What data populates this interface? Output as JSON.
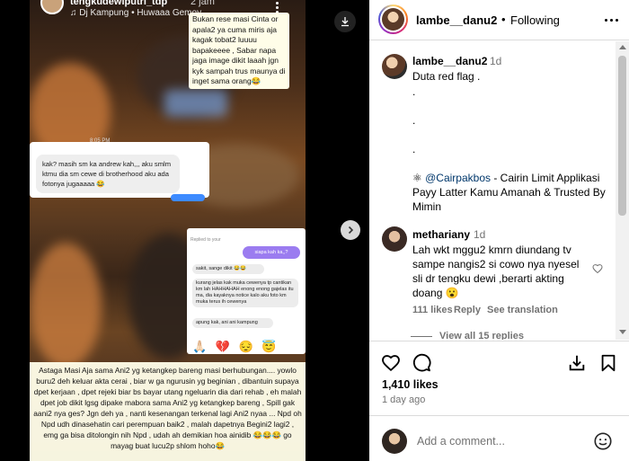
{
  "story": {
    "username": "tengkudewiputri_tdp",
    "time": "2 jam",
    "music": "♫ Dj Kampung • Huwaaa Gemoy"
  },
  "overlay": {
    "top_right_text": "Bukan rese masi Cinta or apala2 ya cuma miris aja kagak tobat2 luuuu bapakeeee , Sabar napa jaga image dikit laaah jgn kyk sampah trus maunya di inget sama orang😂",
    "chat_time": "8:05 PM",
    "chat_text": "kak? masih sm ka andrew kah,,, aku smlm ktmu dia sm cewe di brotherhood aku ada fotonya jugaaaaa 😂",
    "dm": {
      "replied": "Replied to your",
      "bubble_purple": "siapa kah ka,,?",
      "line1": "sakit, sange dikit 😂😂",
      "line2": "kurang jelas kak muka cewenya tp cantikan km lah HAHHAHAH enong enong gajelas itu ma, dia kayaknya notice kalo aku foto km muka terus ih cewenya",
      "line3": "apung kak, ani ani kampung",
      "emojis": "🙏🏻 💔 😔 😇"
    },
    "bottom_caption": "Astaga Masi Aja sama Ani2 yg ketangkep bareng masi berhubungan.... yowlo buru2 deh keluar akta cerai , biar w ga ngurusin yg beginian , dibantuin supaya dpet kerjaan , dpet rejeki biar bs bayar utang ngeluarin dia dari rehab , eh malah dpet job dikit lgsg dipake mabora sama Ani2 yg ketangkep bareng , Spill gak aani2 nya ges? Jgn deh ya , nanti kesenangan terkenal lagi Ani2 nyaa ... Npd oh Npd udh dinasehatin cari perempuan baik2 , malah dapetnya Begini2 lagi2 , emg ga bisa ditolongin nih Npd , udah ah demikian hoa ainidib 😂😂😂 go mayag buat lucu2p shlom hoho😂"
  },
  "post": {
    "author": "lambe__danu2",
    "follow_label": "Following",
    "dot": "•",
    "caption_user": "lambe__danu2",
    "caption_time": "1d",
    "caption_lines": [
      "Duta red flag .",
      ".",
      ".",
      "."
    ],
    "caption_promo_mention": "@Cairpakbos",
    "caption_promo_emoji": "⚛",
    "caption_promo_rest": " - Cairin Limit Applikasi Payy Latter Kamu Amanah & Trusted By Mimin",
    "comment": {
      "user": "metharianу",
      "time": "1d",
      "text": "Lah wkt mggu2 kmrn diundang tv sampe nangis2 si cowo nya nyesel sli dr tengku dewi ,berarti akting doang 😮",
      "likes": "111 likes",
      "reply": "Reply",
      "translate": "See translation"
    },
    "view_all": "View all 15 replies",
    "likes_count": "1,410 likes",
    "ago": "1 day ago",
    "add_comment_placeholder": "Add a comment..."
  },
  "icons": {
    "heart": "heart-icon",
    "comment": "comment-icon",
    "share": "share-icon",
    "save": "bookmark-icon",
    "download": "download-icon",
    "next": "chevron-right-icon",
    "emoji": "emoji-icon"
  }
}
